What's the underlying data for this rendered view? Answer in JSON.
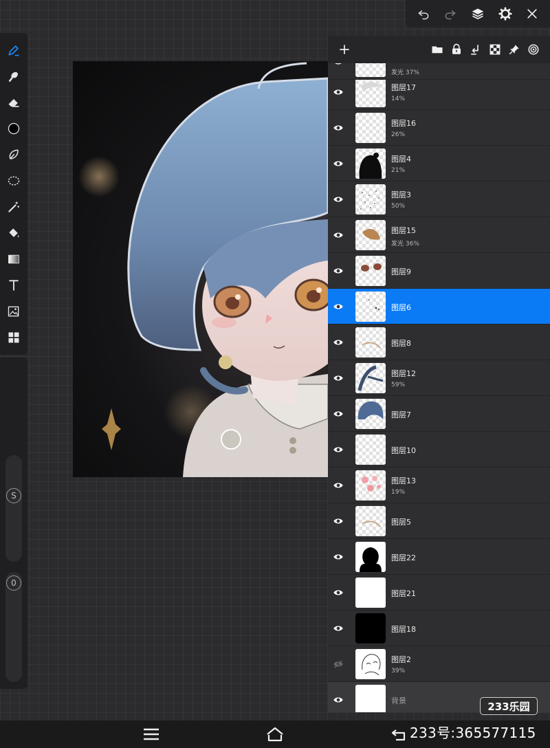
{
  "topbar": {
    "buttons": [
      {
        "name": "undo-icon"
      },
      {
        "name": "redo-icon"
      },
      {
        "name": "layers-icon"
      },
      {
        "name": "gear-icon"
      },
      {
        "name": "close-icon"
      }
    ]
  },
  "tools": [
    {
      "name": "pen-tool-icon",
      "active": true
    },
    {
      "name": "smudge-tool-icon"
    },
    {
      "name": "eraser-tool-icon"
    },
    {
      "name": "color-picker-icon"
    },
    {
      "name": "lasso-tool-icon"
    },
    {
      "name": "selection-tool-icon"
    },
    {
      "name": "magic-wand-icon"
    },
    {
      "name": "fill-bucket-icon"
    },
    {
      "name": "gradient-tool-icon"
    },
    {
      "name": "text-tool-icon"
    },
    {
      "name": "image-import-icon"
    },
    {
      "name": "grid-tool-icon"
    }
  ],
  "sliders": {
    "size_label": "S",
    "opacity_label": "0"
  },
  "layers_panel": {
    "header_buttons": [
      "folder-icon",
      "lock-icon",
      "merge-down-icon",
      "transparency-icon",
      "pin-icon",
      "target-icon"
    ],
    "partial_top_layer_meta": "发光  37%",
    "layers": [
      {
        "name": "图层17",
        "meta": "14%",
        "visible": true,
        "thumb": "light"
      },
      {
        "name": "图层16",
        "meta": "26%",
        "visible": true,
        "thumb": "empty"
      },
      {
        "name": "图层4",
        "meta": "21%",
        "visible": true,
        "thumb": "dark-blob"
      },
      {
        "name": "图层3",
        "meta": "50%",
        "visible": true,
        "thumb": "sketch"
      },
      {
        "name": "图层15",
        "meta": "发光  36%",
        "visible": true,
        "thumb": "brown"
      },
      {
        "name": "图层9",
        "meta": "",
        "visible": true,
        "thumb": "eyes"
      },
      {
        "name": "图层6",
        "meta": "",
        "visible": true,
        "thumb": "dots",
        "selected": true
      },
      {
        "name": "图层8",
        "meta": "",
        "visible": true,
        "thumb": "faint"
      },
      {
        "name": "图层12",
        "meta": "59%",
        "visible": true,
        "thumb": "hair-strands"
      },
      {
        "name": "图层7",
        "meta": "",
        "visible": true,
        "thumb": "blue-hair"
      },
      {
        "name": "图层10",
        "meta": "",
        "visible": true,
        "thumb": "empty"
      },
      {
        "name": "图层13",
        "meta": "19%",
        "visible": true,
        "thumb": "pink"
      },
      {
        "name": "图层5",
        "meta": "",
        "visible": true,
        "thumb": "faint"
      },
      {
        "name": "图层22",
        "meta": "",
        "visible": true,
        "thumb": "silhouette"
      },
      {
        "name": "图层21",
        "meta": "",
        "visible": true,
        "thumb": "white"
      },
      {
        "name": "图层18",
        "meta": "",
        "visible": true,
        "thumb": "black"
      },
      {
        "name": "图层2",
        "meta": "39%",
        "visible": false,
        "thumb": "lineart"
      },
      {
        "name": "背景",
        "meta": "",
        "visible": true,
        "thumb": "white",
        "background": true
      }
    ]
  },
  "navbar": {
    "buttons": [
      "menu-icon",
      "home-icon",
      "back-icon"
    ]
  },
  "watermark": {
    "id_text": "233号:365577115",
    "logo_text": "233乐园"
  },
  "colors": {
    "accent": "#0a7af5",
    "panel": "#2e2e30",
    "toolbar": "#1f1f21",
    "canvas_bg": "#2b2b2d"
  }
}
